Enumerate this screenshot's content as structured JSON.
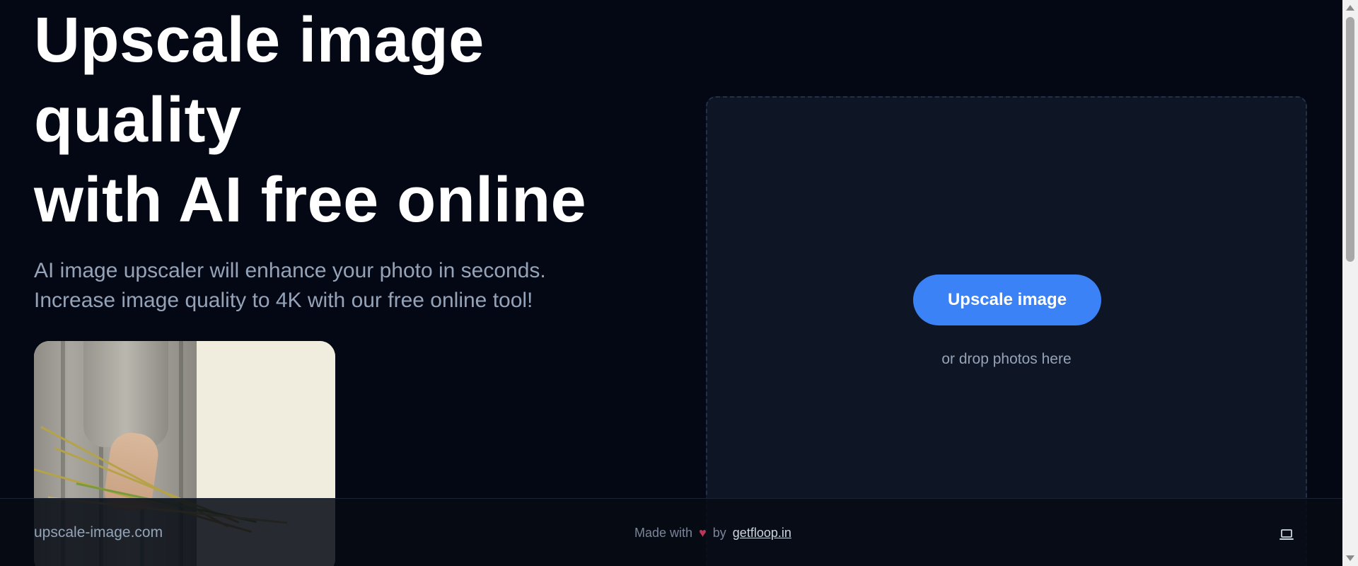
{
  "hero": {
    "title_lines": [
      "Upscale image",
      "quality",
      "with AI free online"
    ],
    "subtitle_lines": [
      "AI image upscaler will enhance your photo in seconds.",
      "Increase image quality to 4K with our free online tool!"
    ]
  },
  "upload": {
    "button_label": "Upscale image",
    "drop_hint": "or drop photos here"
  },
  "footer": {
    "site_name": "upscale-image.com",
    "made_with": "Made with",
    "heart": "♥",
    "by": "by",
    "credit_link": "getfloop.in",
    "device_icon": "laptop-icon"
  },
  "colors": {
    "background": "#040814",
    "accent": "#3b82f6",
    "muted_text": "#94a3b8",
    "dropzone_bg": "#0e1524"
  },
  "icons": {
    "heart": "heart-icon",
    "theme_toggle": "laptop-icon"
  }
}
